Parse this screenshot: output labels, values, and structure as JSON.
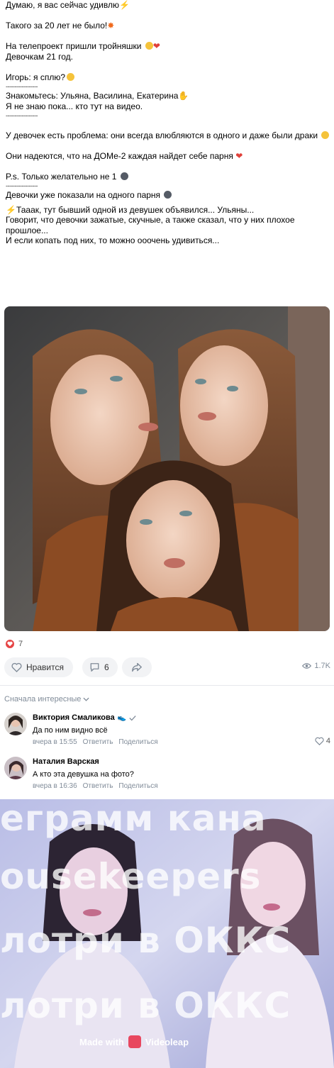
{
  "post": {
    "lines": [
      "Думаю, я вас сейчас удивлю",
      "",
      "Такого за 20 лет не было!",
      "",
      "На телепроект пришли тройняшки",
      "Девочкам 21 год.",
      "",
      "Игорь: я сплю?",
      "------------------",
      "Знакомьтесь: Ульяна, Василина, Екатерина",
      "Я не знаю пока... кто тут на видео.",
      "------------------",
      "",
      "У девочек есть проблема: они всегда влюбляются в одного и даже были драки",
      "",
      "Они надеются, что на ДОМе-2 каждая найдет себе парня",
      "",
      "P.s. Только желательно не 1",
      "------------------",
      "Девочки уже показали на одного парня",
      "",
      "Тааак, тут бывший одной из девушек объявился... Ульяны...",
      "Говорит, что девочки зажатые, скучные, а также сказал, что у них плохое",
      "прошлое...",
      "И если копать под них, то можно ооочень удивиться..."
    ],
    "likes_count": "7",
    "like_label": "Нравится",
    "comments_count": "6",
    "views": "1.7K"
  },
  "comments_section": {
    "sort_label": "Сначала интересные",
    "comments": [
      {
        "author": "Виктория Смаликова",
        "text": "Да по ним видно всё",
        "time": "вчера в 15:55",
        "reply": "Ответить",
        "share": "Поделиться",
        "likes": "4"
      },
      {
        "author": "Наталия Варская",
        "text": "А кто эта девушка на фото?",
        "time": "вчера в 16:36",
        "reply": "Ответить",
        "share": "Поделиться"
      }
    ]
  },
  "video": {
    "watermark_lines": [
      "еграмм кана",
      "ousekeepers",
      "лотри в ОККС",
      "лотри в ОККС"
    ],
    "made_with": "Made with",
    "brand": "Videoleap"
  },
  "colors": {
    "accent": "#e64646",
    "muted": "#818c99",
    "button_bg": "#f2f3f5"
  }
}
